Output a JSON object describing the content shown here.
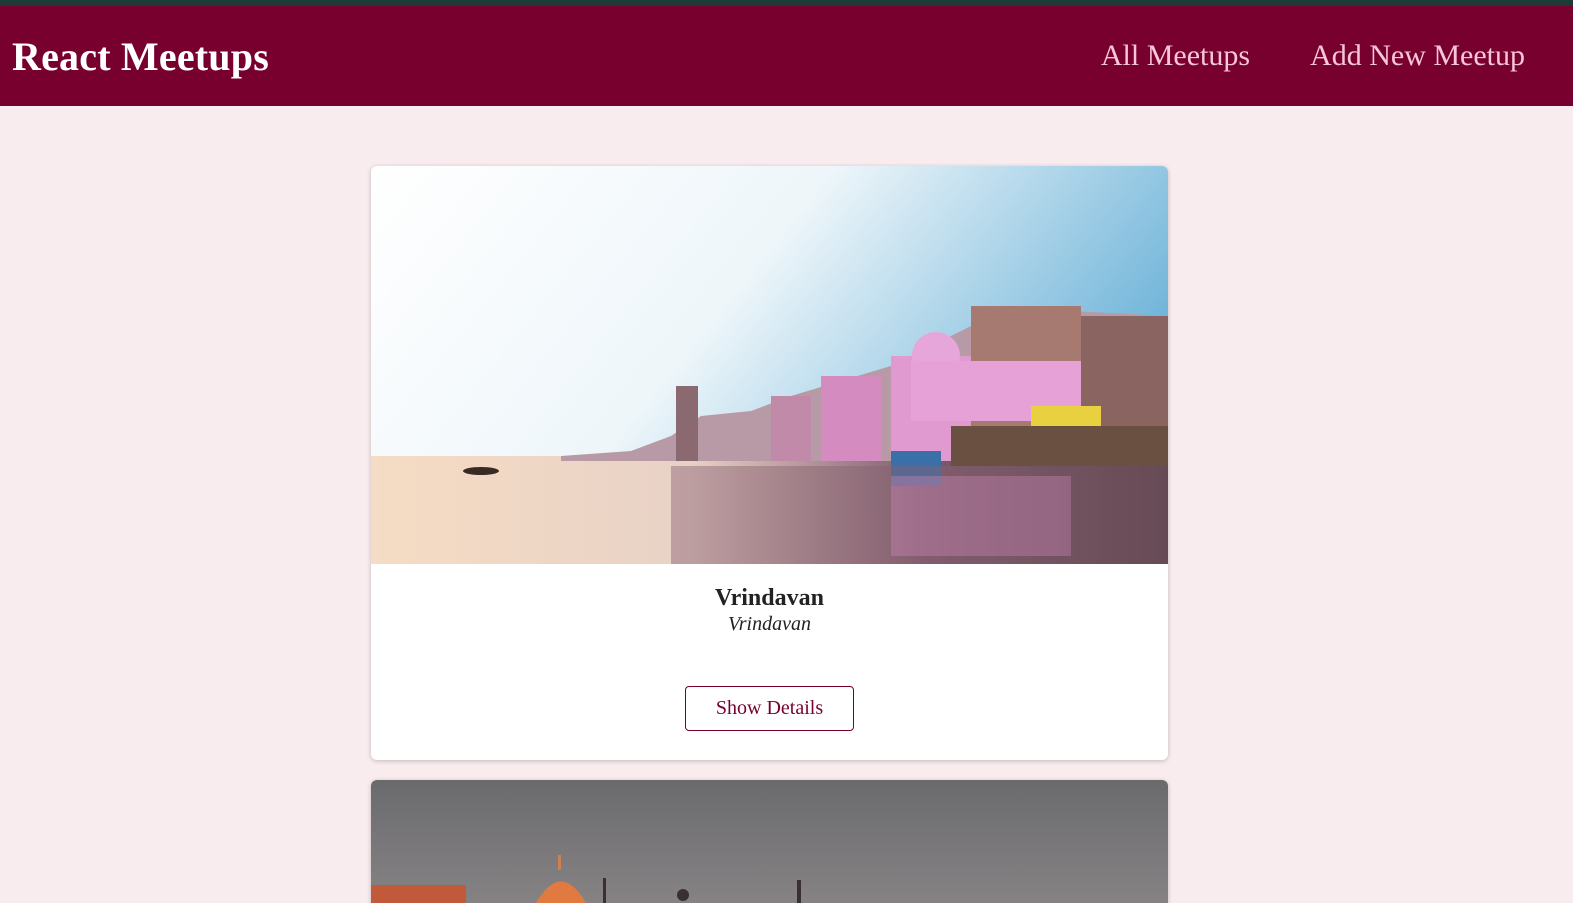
{
  "header": {
    "logo": "React Meetups",
    "nav": [
      {
        "label": "All Meetups"
      },
      {
        "label": "Add New Meetup"
      }
    ]
  },
  "meetups": [
    {
      "title": "Vrindavan",
      "address": "Vrindavan",
      "image_alt": "riverside ghats with pink temples at sunrise",
      "action_label": "Show Details"
    },
    {
      "image_alt": "temple domes at dusk"
    }
  ],
  "colors": {
    "header_bg": "#77002f",
    "page_bg": "#f8ecee",
    "nav_text": "#f7c6d8",
    "accent": "#77002f"
  }
}
